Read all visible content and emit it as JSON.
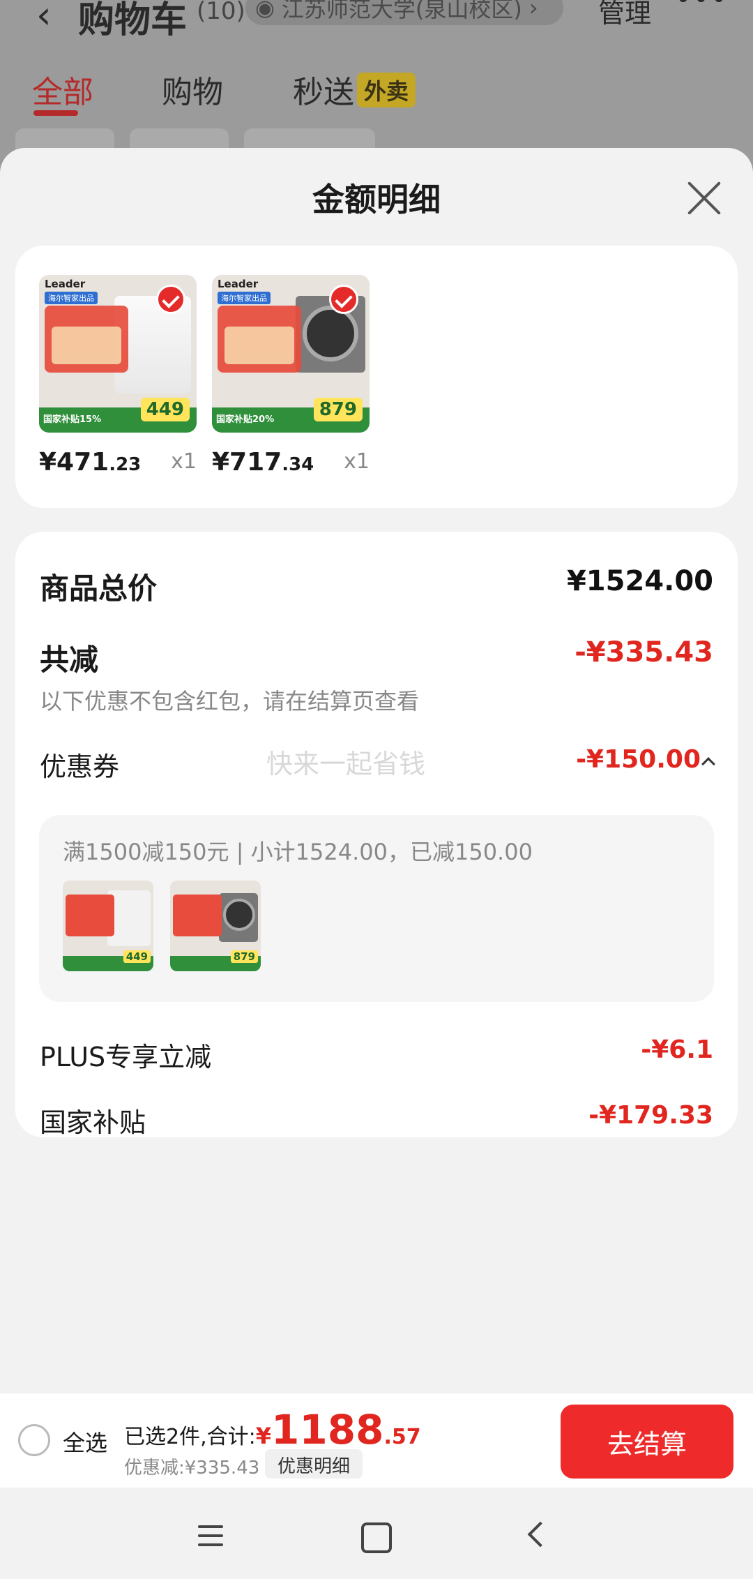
{
  "background": {
    "title": "购物车",
    "count": "(10)",
    "location": "江苏师范大学(泉山校区)",
    "manage": "管理",
    "tabs": [
      "全部",
      "购物",
      "秒送"
    ],
    "badge": "外卖"
  },
  "sheet": {
    "title": "金额明细",
    "products": [
      {
        "price_int": "¥471",
        "price_dec": ".23",
        "qty": "x1",
        "tag": "国家补贴15%",
        "img_price": "449"
      },
      {
        "price_int": "¥717",
        "price_dec": ".34",
        "qty": "x1",
        "tag": "国家补贴20%",
        "img_price": "879"
      }
    ],
    "total_label": "商品总价",
    "total_value": "¥1524.00",
    "reduce_label": "共减",
    "reduce_value": "-¥335.43",
    "reduce_note": "以下优惠不包含红包，请在结算页查看",
    "watermark": "快来一起省钱",
    "coupon_label": "优惠券",
    "coupon_value": "-¥150.00",
    "coupon_detail": "满1500减150元 | 小计1524.00，已减150.00",
    "plus_label": "PLUS专享立减",
    "plus_value": "-¥6.1",
    "subsidy_label": "国家补贴",
    "subsidy_value": "-¥179.33"
  },
  "bottom": {
    "select_all": "全选",
    "summary_prefix": "已选2件,合计:",
    "currency": "¥",
    "total_int": "1188",
    "total_dec": ".57",
    "discount": "优惠减:¥335.43",
    "detail_button": "优惠明细",
    "checkout": "去结算"
  },
  "colors": {
    "accent": "#e0261f",
    "checkout": "#ee2a2a"
  }
}
